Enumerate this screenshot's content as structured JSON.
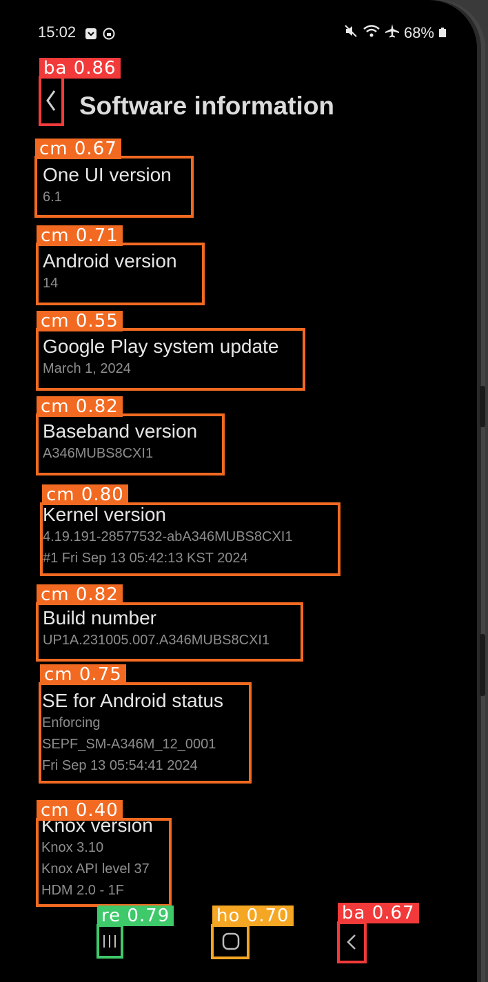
{
  "status_bar": {
    "time": "15:02",
    "battery": "68%"
  },
  "header": {
    "title": "Software information"
  },
  "items": [
    {
      "title": "One UI version",
      "lines": [
        "6.1"
      ]
    },
    {
      "title": "Android version",
      "lines": [
        "14"
      ]
    },
    {
      "title": "Google Play system update",
      "lines": [
        "March 1, 2024"
      ]
    },
    {
      "title": "Baseband version",
      "lines": [
        "A346MUBS8CXI1"
      ]
    },
    {
      "title": "Kernel version",
      "lines": [
        "4.19.191-28577532-abA346MUBS8CXI1",
        "#1 Fri Sep 13 05:42:13 KST 2024"
      ]
    },
    {
      "title": "Build number",
      "lines": [
        "UP1A.231005.007.A346MUBS8CXI1"
      ]
    },
    {
      "title": "SE for Android status",
      "lines": [
        "Enforcing",
        "SEPF_SM-A346M_12_0001",
        "Fri Sep 13 05:54:41 2024"
      ]
    },
    {
      "title": "Knox version",
      "lines": [
        "Knox 3.10",
        "Knox API level 37",
        "HDM 2.0 - 1F"
      ]
    }
  ],
  "detections": {
    "back_top": "ba 0.86",
    "items": [
      "cm 0.67",
      "cm 0.71",
      "cm 0.55",
      "cm 0.82",
      "cm 0.80",
      "cm 0.82",
      "cm 0.75",
      "cm 0.40"
    ],
    "recents": "re 0.79",
    "home": "ho 0.70",
    "back_nav": "ba 0.67"
  },
  "colors": {
    "item_box": "#f26a21",
    "back_box": "#f23a3a",
    "recents_box": "#3ec96b",
    "home_box": "#f5a623"
  }
}
